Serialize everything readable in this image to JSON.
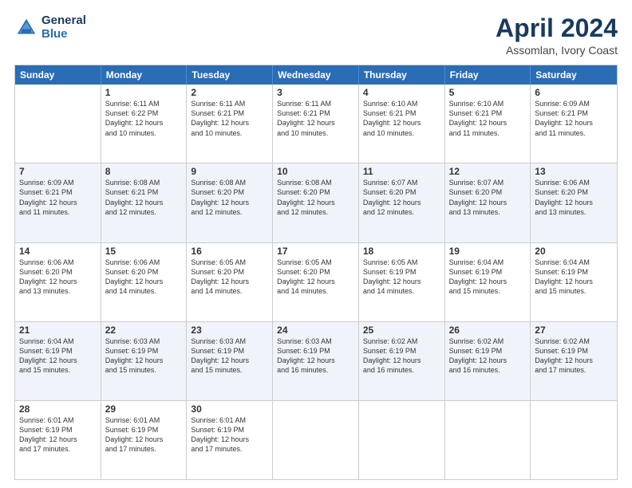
{
  "logo": {
    "line1": "General",
    "line2": "Blue"
  },
  "title": "April 2024",
  "location": "Assomlan, Ivory Coast",
  "header_days": [
    "Sunday",
    "Monday",
    "Tuesday",
    "Wednesday",
    "Thursday",
    "Friday",
    "Saturday"
  ],
  "weeks": [
    [
      {
        "day": "",
        "info": ""
      },
      {
        "day": "1",
        "info": "Sunrise: 6:11 AM\nSunset: 6:22 PM\nDaylight: 12 hours\nand 10 minutes."
      },
      {
        "day": "2",
        "info": "Sunrise: 6:11 AM\nSunset: 6:21 PM\nDaylight: 12 hours\nand 10 minutes."
      },
      {
        "day": "3",
        "info": "Sunrise: 6:11 AM\nSunset: 6:21 PM\nDaylight: 12 hours\nand 10 minutes."
      },
      {
        "day": "4",
        "info": "Sunrise: 6:10 AM\nSunset: 6:21 PM\nDaylight: 12 hours\nand 10 minutes."
      },
      {
        "day": "5",
        "info": "Sunrise: 6:10 AM\nSunset: 6:21 PM\nDaylight: 12 hours\nand 11 minutes."
      },
      {
        "day": "6",
        "info": "Sunrise: 6:09 AM\nSunset: 6:21 PM\nDaylight: 12 hours\nand 11 minutes."
      }
    ],
    [
      {
        "day": "7",
        "info": "Sunrise: 6:09 AM\nSunset: 6:21 PM\nDaylight: 12 hours\nand 11 minutes."
      },
      {
        "day": "8",
        "info": "Sunrise: 6:08 AM\nSunset: 6:21 PM\nDaylight: 12 hours\nand 12 minutes."
      },
      {
        "day": "9",
        "info": "Sunrise: 6:08 AM\nSunset: 6:20 PM\nDaylight: 12 hours\nand 12 minutes."
      },
      {
        "day": "10",
        "info": "Sunrise: 6:08 AM\nSunset: 6:20 PM\nDaylight: 12 hours\nand 12 minutes."
      },
      {
        "day": "11",
        "info": "Sunrise: 6:07 AM\nSunset: 6:20 PM\nDaylight: 12 hours\nand 12 minutes."
      },
      {
        "day": "12",
        "info": "Sunrise: 6:07 AM\nSunset: 6:20 PM\nDaylight: 12 hours\nand 13 minutes."
      },
      {
        "day": "13",
        "info": "Sunrise: 6:06 AM\nSunset: 6:20 PM\nDaylight: 12 hours\nand 13 minutes."
      }
    ],
    [
      {
        "day": "14",
        "info": "Sunrise: 6:06 AM\nSunset: 6:20 PM\nDaylight: 12 hours\nand 13 minutes."
      },
      {
        "day": "15",
        "info": "Sunrise: 6:06 AM\nSunset: 6:20 PM\nDaylight: 12 hours\nand 14 minutes."
      },
      {
        "day": "16",
        "info": "Sunrise: 6:05 AM\nSunset: 6:20 PM\nDaylight: 12 hours\nand 14 minutes."
      },
      {
        "day": "17",
        "info": "Sunrise: 6:05 AM\nSunset: 6:20 PM\nDaylight: 12 hours\nand 14 minutes."
      },
      {
        "day": "18",
        "info": "Sunrise: 6:05 AM\nSunset: 6:19 PM\nDaylight: 12 hours\nand 14 minutes."
      },
      {
        "day": "19",
        "info": "Sunrise: 6:04 AM\nSunset: 6:19 PM\nDaylight: 12 hours\nand 15 minutes."
      },
      {
        "day": "20",
        "info": "Sunrise: 6:04 AM\nSunset: 6:19 PM\nDaylight: 12 hours\nand 15 minutes."
      }
    ],
    [
      {
        "day": "21",
        "info": "Sunrise: 6:04 AM\nSunset: 6:19 PM\nDaylight: 12 hours\nand 15 minutes."
      },
      {
        "day": "22",
        "info": "Sunrise: 6:03 AM\nSunset: 6:19 PM\nDaylight: 12 hours\nand 15 minutes."
      },
      {
        "day": "23",
        "info": "Sunrise: 6:03 AM\nSunset: 6:19 PM\nDaylight: 12 hours\nand 15 minutes."
      },
      {
        "day": "24",
        "info": "Sunrise: 6:03 AM\nSunset: 6:19 PM\nDaylight: 12 hours\nand 16 minutes."
      },
      {
        "day": "25",
        "info": "Sunrise: 6:02 AM\nSunset: 6:19 PM\nDaylight: 12 hours\nand 16 minutes."
      },
      {
        "day": "26",
        "info": "Sunrise: 6:02 AM\nSunset: 6:19 PM\nDaylight: 12 hours\nand 16 minutes."
      },
      {
        "day": "27",
        "info": "Sunrise: 6:02 AM\nSunset: 6:19 PM\nDaylight: 12 hours\nand 17 minutes."
      }
    ],
    [
      {
        "day": "28",
        "info": "Sunrise: 6:01 AM\nSunset: 6:19 PM\nDaylight: 12 hours\nand 17 minutes."
      },
      {
        "day": "29",
        "info": "Sunrise: 6:01 AM\nSunset: 6:19 PM\nDaylight: 12 hours\nand 17 minutes."
      },
      {
        "day": "30",
        "info": "Sunrise: 6:01 AM\nSunset: 6:19 PM\nDaylight: 12 hours\nand 17 minutes."
      },
      {
        "day": "",
        "info": ""
      },
      {
        "day": "",
        "info": ""
      },
      {
        "day": "",
        "info": ""
      },
      {
        "day": "",
        "info": ""
      }
    ]
  ]
}
